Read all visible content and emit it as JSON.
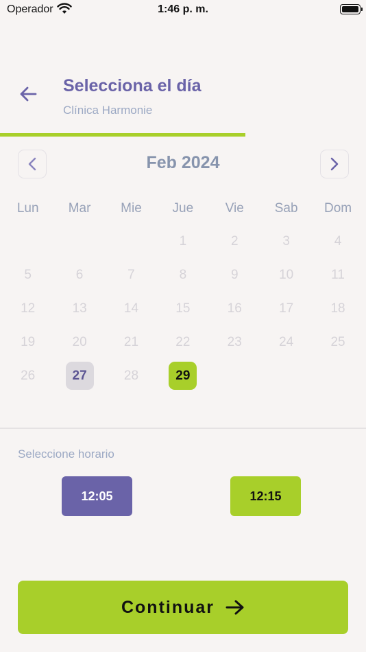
{
  "status_bar": {
    "carrier": "Operador",
    "time": "1:46 p. m."
  },
  "header": {
    "title": "Selecciona el día",
    "subtitle": "Clínica Harmonie",
    "progress": 0.67
  },
  "calendar": {
    "month_label": "Feb 2024",
    "weekdays": [
      "Lun",
      "Mar",
      "Mie",
      "Jue",
      "Vie",
      "Sab",
      "Dom"
    ],
    "leading_blanks": 3,
    "days": [
      "1",
      "2",
      "3",
      "4",
      "5",
      "6",
      "7",
      "8",
      "9",
      "10",
      "11",
      "12",
      "13",
      "14",
      "15",
      "16",
      "17",
      "18",
      "19",
      "20",
      "21",
      "22",
      "23",
      "24",
      "25",
      "26",
      "27",
      "28",
      "29"
    ],
    "highlighted_day": "27",
    "selected_day": "29"
  },
  "schedule": {
    "label": "Seleccione horario",
    "slots": [
      "12:05",
      "12:15"
    ]
  },
  "footer": {
    "continue_label": "Continuar"
  },
  "colors": {
    "accent_purple": "#6a63a8",
    "accent_green": "#a8cf2a",
    "background": "#f7f4f3"
  }
}
